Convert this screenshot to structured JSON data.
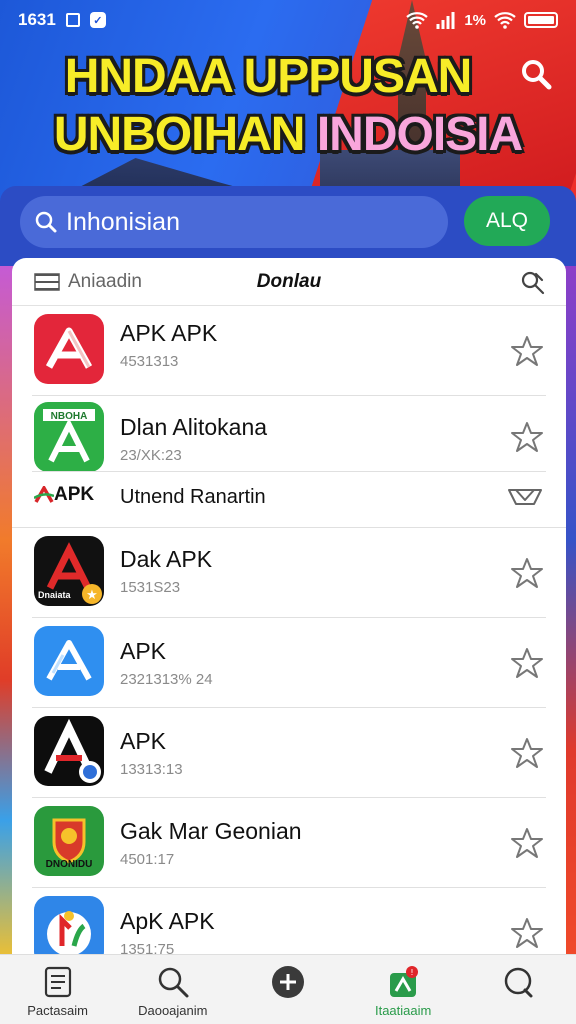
{
  "status_bar": {
    "time": "1631",
    "network": "1%"
  },
  "banner": {
    "title_line1": "HNDAA UPPUSAN",
    "title_line2_a": "UNBOIHAN ",
    "title_line2_b": "INDOISIA"
  },
  "search": {
    "placeholder": "Inhonisian",
    "button_label": "ALQ"
  },
  "list_header": {
    "sort_label": "Aniaadin",
    "title": "Donlau"
  },
  "apps": [
    {
      "name": "APK APK",
      "meta": "4531313",
      "icon": "red-apk-icon"
    },
    {
      "name": "Dlan Alitokana",
      "meta": "23/XK:23",
      "icon": "green-apk-icon"
    },
    {
      "name": "Utnend Ranartin",
      "meta": "",
      "icon_text": "APK",
      "icon": "apk-logo"
    },
    {
      "name": "Dak APK",
      "meta": "1531S23",
      "icon": "black-red-apk-icon",
      "icon_text": "Dnaiata"
    },
    {
      "name": "APK",
      "meta": "2321313% 24",
      "icon": "blue-apk-icon"
    },
    {
      "name": "APK",
      "meta": "13313:13",
      "icon": "black-apk-icon"
    },
    {
      "name": "Gak Mar Geonian",
      "meta": "4501:17",
      "icon": "green-emblem-icon",
      "icon_text": "DNONIDU"
    },
    {
      "name": "ApK APK",
      "meta": "1351:75",
      "icon": "blue-flower-icon"
    }
  ],
  "bottom_nav": [
    {
      "label": "Pactasaim",
      "icon": "document-icon"
    },
    {
      "label": "Daooajanim",
      "icon": "search-icon"
    },
    {
      "label": "",
      "icon": "plus-icon"
    },
    {
      "label": "Itaatiaaim",
      "icon": "download-icon",
      "active": true
    },
    {
      "label": "",
      "icon": "chat-icon"
    }
  ],
  "colors": {
    "accent_green": "#22a957",
    "search_blue": "#2c4cc4",
    "headline_yellow": "#f7ec28"
  }
}
